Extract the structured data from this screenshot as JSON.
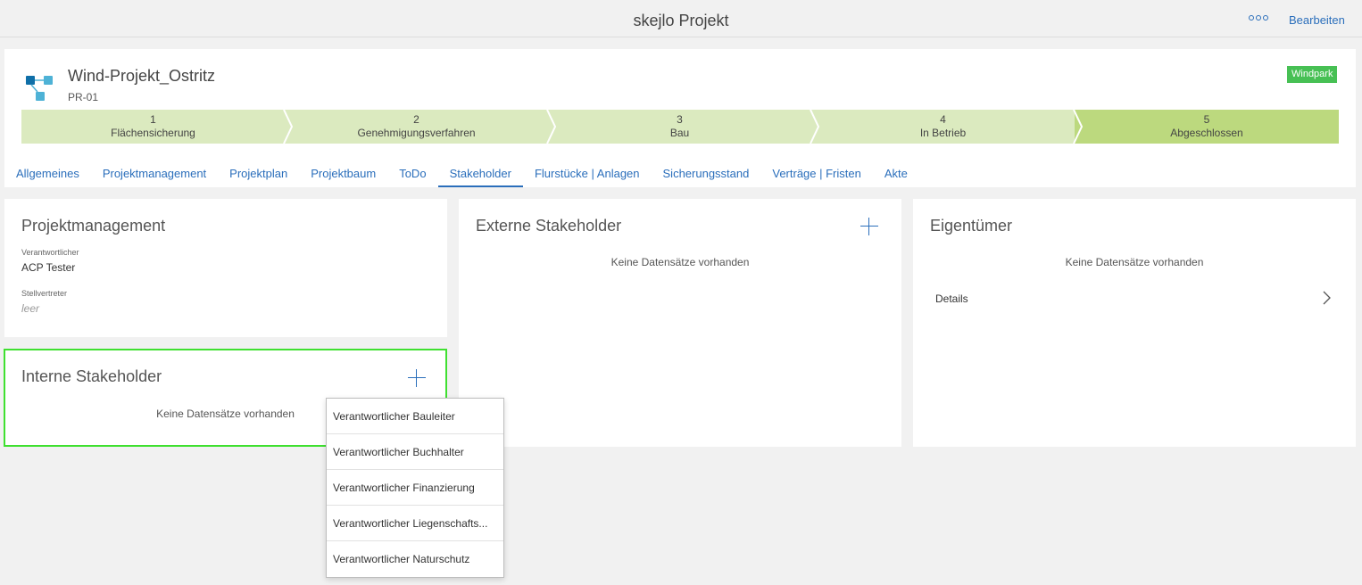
{
  "app": {
    "title": "skejlo Projekt",
    "more_icon": "more-horizontal-icon",
    "edit_label": "Bearbeiten"
  },
  "project": {
    "icon": "hierarchy-icon",
    "name": "Wind-Projekt_Ostritz",
    "code": "PR-01",
    "badge": "Windpark",
    "badge_color": "#47c054"
  },
  "process": {
    "steps": [
      {
        "num": "1",
        "label": "Flächensicherung"
      },
      {
        "num": "2",
        "label": "Genehmigungsverfahren"
      },
      {
        "num": "3",
        "label": "Bau"
      },
      {
        "num": "4",
        "label": "In Betrieb"
      },
      {
        "num": "5",
        "label": "Abgeschlossen"
      }
    ],
    "step_color": "#dbeabf",
    "active_step_color": "#bcd97e"
  },
  "tabs": [
    {
      "label": "Allgemeines"
    },
    {
      "label": "Projektmanagement"
    },
    {
      "label": "Projektplan"
    },
    {
      "label": "Projektbaum"
    },
    {
      "label": "ToDo"
    },
    {
      "label": "Stakeholder"
    },
    {
      "label": "Flurstücke | Anlagen"
    },
    {
      "label": "Sicherungsstand"
    },
    {
      "label": "Verträge | Fristen"
    },
    {
      "label": "Akte"
    }
  ],
  "active_tab": "Stakeholder",
  "pm_card": {
    "title": "Projektmanagement",
    "responsible_label": "Verantwortlicher",
    "responsible_value": "ACP Tester",
    "deputy_label": "Stellvertreter",
    "deputy_value": "leer"
  },
  "internal_card": {
    "title": "Interne Stakeholder",
    "empty": "Keine Datensätze vorhanden",
    "highlight_color": "#3fe030"
  },
  "external_card": {
    "title": "Externe Stakeholder",
    "empty": "Keine Datensätze vorhanden"
  },
  "owner_card": {
    "title": "Eigentümer",
    "empty": "Keine Datensätze vorhanden",
    "details_label": "Details"
  },
  "menu": {
    "items": [
      {
        "label": "Verantwortlicher Bauleiter"
      },
      {
        "label": "Verantwortlicher Buchhalter"
      },
      {
        "label": "Verantwortlicher Finanzierung"
      },
      {
        "label": "Verantwortlicher Liegenschafts..."
      },
      {
        "label": "Verantwortlicher Naturschutz"
      }
    ]
  },
  "colors": {
    "accent": "#2a6ebb",
    "background": "#f1f1f1"
  }
}
